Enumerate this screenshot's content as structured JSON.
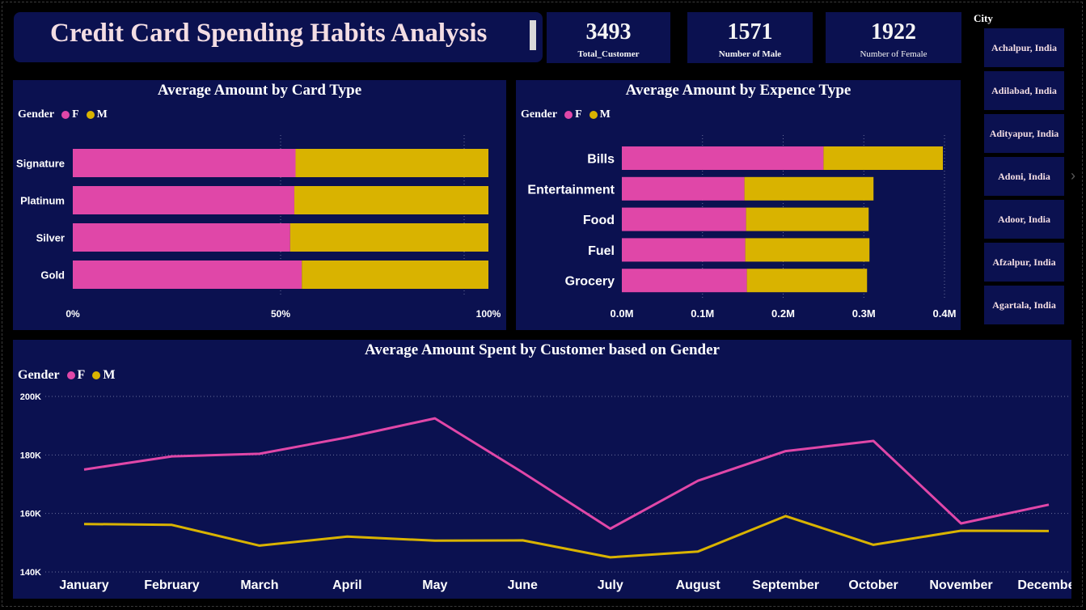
{
  "dashboard": {
    "title": "Credit Card Spending Habits Analysis"
  },
  "kpis": [
    {
      "value": "3493",
      "label": "Total_Customer"
    },
    {
      "value": "1571",
      "label": "Number of Male"
    },
    {
      "value": "1922",
      "label": "Number of Female"
    }
  ],
  "slicer": {
    "label": "City",
    "items": [
      "Achalpur, India",
      "Adilabad, India",
      "Adityapur, India",
      "Adoni, India",
      "Adoor, India",
      "Afzalpur, India",
      "Agartala, India"
    ]
  },
  "legend": {
    "title": "Gender",
    "female": "F",
    "male": "M"
  },
  "colors": {
    "female": "#e047a8",
    "male": "#d9b300",
    "panel": "#0b1150",
    "background": "#000000"
  },
  "chart_data": [
    {
      "type": "bar",
      "stacking": "percent",
      "orientation": "horizontal",
      "title": "Average Amount by Card Type",
      "categories": [
        "Signature",
        "Platinum",
        "Silver",
        "Gold"
      ],
      "series": [
        {
          "name": "F",
          "values": [
            53.6,
            53.3,
            52.3,
            55.1
          ]
        },
        {
          "name": "M",
          "values": [
            46.4,
            46.7,
            47.7,
            44.9
          ]
        }
      ],
      "xticks": [
        "0%",
        "50%",
        "100%"
      ],
      "xlim": [
        0,
        100
      ]
    },
    {
      "type": "bar",
      "stacking": "stacked",
      "orientation": "horizontal",
      "title": "Average Amount by Expence Type",
      "categories": [
        "Bills",
        "Entertainment",
        "Food",
        "Fuel",
        "Grocery"
      ],
      "series": [
        {
          "name": "F",
          "values": [
            0.25,
            0.152,
            0.154,
            0.153,
            0.155
          ]
        },
        {
          "name": "M",
          "values": [
            0.148,
            0.16,
            0.152,
            0.154,
            0.149
          ]
        }
      ],
      "xticks": [
        "0.0M",
        "0.1M",
        "0.2M",
        "0.3M",
        "0.4M"
      ],
      "xlim": [
        0,
        0.4
      ]
    },
    {
      "type": "line",
      "title": "Average Amount Spent by Customer based on Gender",
      "categories": [
        "January",
        "February",
        "March",
        "April",
        "May",
        "June",
        "July",
        "August",
        "September",
        "October",
        "November",
        "December"
      ],
      "series": [
        {
          "name": "F",
          "values": [
            175000,
            179500,
            180400,
            186000,
            192500,
            174000,
            154800,
            171200,
            181300,
            184800,
            156600,
            163000
          ]
        },
        {
          "name": "M",
          "values": [
            156400,
            156100,
            149000,
            152100,
            150700,
            150800,
            145000,
            147000,
            159100,
            149300,
            154100,
            154000
          ]
        }
      ],
      "yticks": [
        "140K",
        "160K",
        "180K",
        "200K"
      ],
      "ylim": [
        140000,
        200000
      ],
      "grid": true
    }
  ]
}
